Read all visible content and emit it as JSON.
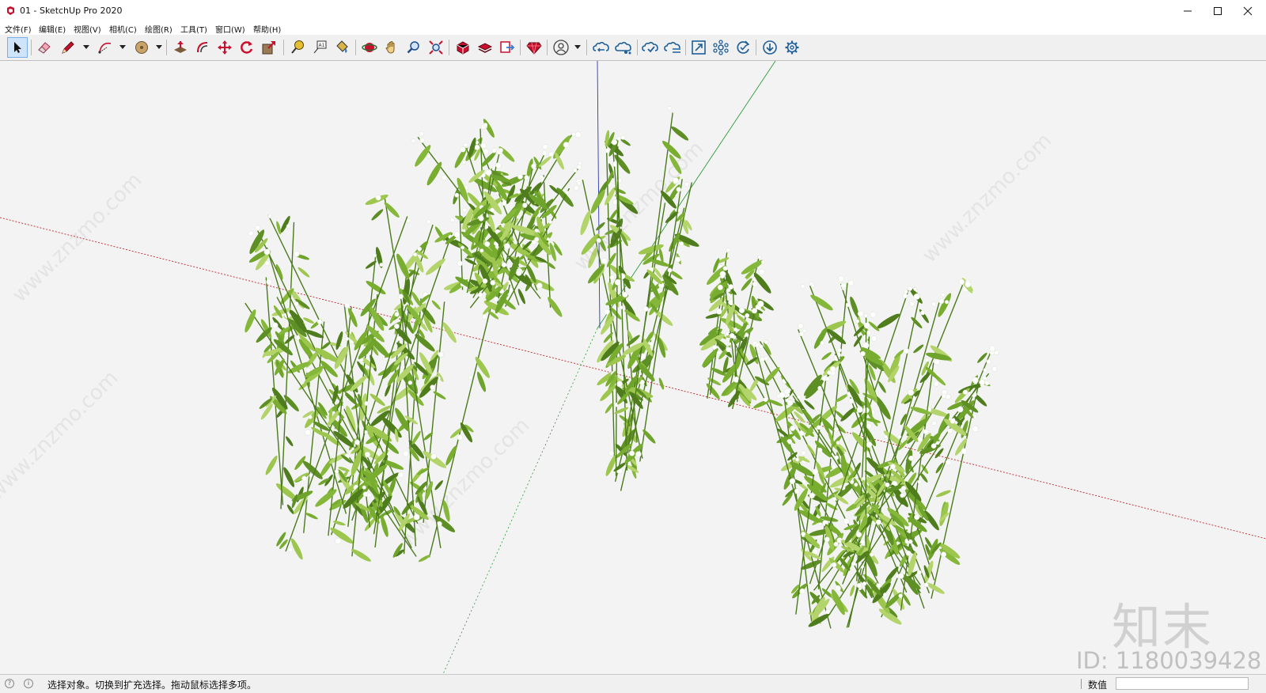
{
  "window": {
    "title": "01 - SketchUp Pro 2020",
    "controls": [
      "minimize",
      "maximize",
      "close"
    ]
  },
  "menu": {
    "items": [
      "文件(F)",
      "编辑(E)",
      "视图(V)",
      "相机(C)",
      "绘图(R)",
      "工具(T)",
      "窗口(W)",
      "帮助(H)"
    ]
  },
  "toolbar": {
    "tools": [
      {
        "id": "select",
        "icon": "select-arrow-icon",
        "active": true
      },
      {
        "id": "eraser",
        "icon": "eraser-icon"
      },
      {
        "id": "line",
        "icon": "pencil-icon",
        "dropdown": true
      },
      {
        "id": "arc",
        "icon": "arc-icon",
        "dropdown": true
      },
      {
        "id": "shapes",
        "icon": "circle-shape-icon",
        "dropdown": true
      },
      {
        "id": "push-pull",
        "icon": "push-pull-icon"
      },
      {
        "id": "offset",
        "icon": "offset-icon"
      },
      {
        "id": "move",
        "icon": "move-icon"
      },
      {
        "id": "rotate",
        "icon": "rotate-icon"
      },
      {
        "id": "scale",
        "icon": "scale-icon"
      },
      {
        "id": "tape",
        "icon": "tape-measure-icon"
      },
      {
        "id": "text",
        "icon": "text-label-icon"
      },
      {
        "id": "paint",
        "icon": "paint-bucket-icon"
      },
      {
        "id": "orbit",
        "icon": "orbit-icon"
      },
      {
        "id": "pan",
        "icon": "pan-hand-icon"
      },
      {
        "id": "zoom",
        "icon": "zoom-magnifier-icon"
      },
      {
        "id": "zoom-extents",
        "icon": "zoom-extents-icon"
      },
      {
        "id": "warehouse",
        "icon": "3d-warehouse-icon"
      },
      {
        "id": "extension-warehouse",
        "icon": "extension-warehouse-icon"
      },
      {
        "id": "layout",
        "icon": "send-to-layout-icon"
      },
      {
        "id": "extension-manager",
        "icon": "ruby-gem-icon"
      },
      {
        "id": "account",
        "icon": "user-account-icon",
        "dropdown": true
      },
      {
        "id": "trimble-connect",
        "icon": "cloud-link-icon"
      },
      {
        "id": "cloud-share",
        "icon": "cloud-share-icon"
      },
      {
        "id": "cloud-check",
        "icon": "cloud-check-icon"
      },
      {
        "id": "cloud-sync",
        "icon": "cloud-sync-icon"
      },
      {
        "id": "expand",
        "icon": "expand-icon"
      },
      {
        "id": "network",
        "icon": "network-nodes-icon"
      },
      {
        "id": "refresh",
        "icon": "refresh-check-icon"
      },
      {
        "id": "download",
        "icon": "download-icon"
      },
      {
        "id": "settings",
        "icon": "gear-icon"
      }
    ]
  },
  "viewport": {
    "background": "#f3f3f3",
    "axes": {
      "red": "#c0262c",
      "green": "#2e9a3a",
      "blue": "#2b38b7"
    },
    "model": "four green flowering plant clumps with small white blossoms",
    "watermark_text": "www.znzmo.com",
    "watermark_logo": "知末",
    "watermark_id": "ID: 1180039428"
  },
  "status": {
    "message": "选择对象。切换到扩充选择。拖动鼠标选择多项。",
    "value_label": "数值",
    "value_field": ""
  }
}
